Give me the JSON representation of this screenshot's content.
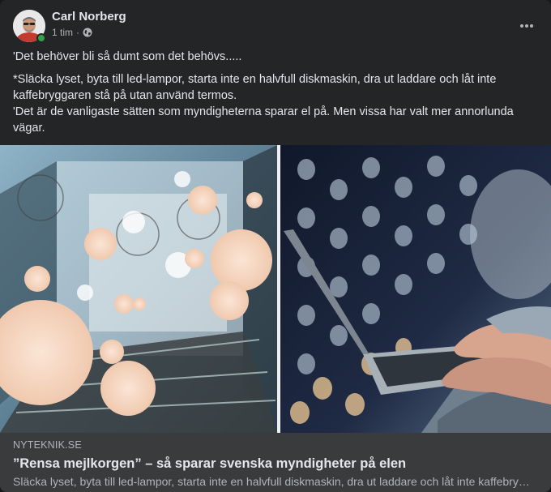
{
  "author": {
    "name": "Carl Norberg",
    "time": "1 tim",
    "separator": "·",
    "online": true
  },
  "post": {
    "lines": [
      "'Det behöver bli så dumt som det behövs.....",
      "*Släcka lyset, byta till led-lampor, starta inte en halvfull diskmaskin, dra ut laddare och låt inte kaffebryggaren stå på utan använd termos.",
      "'Det är de vanligaste sätten som myndigheterna sparar el på. Men vissa har valt mer annorlunda vägar."
    ]
  },
  "link": {
    "domain": "NYTEKNIK.SE",
    "title": "”Rensa mejlkorgen” – så sparar svenska myndigheter på elen",
    "description": "Släcka lyset, byta till led-lampor, starta inte en halvfull diskmaskin, dra ut laddare och låt inte kaffebryggaren stå på utan använd termos."
  },
  "icons": {
    "privacy": "globe-icon",
    "menu": "more-options-icon"
  },
  "colors": {
    "card": "#242526",
    "link_card": "#3a3b3c",
    "online": "#31a24c"
  }
}
